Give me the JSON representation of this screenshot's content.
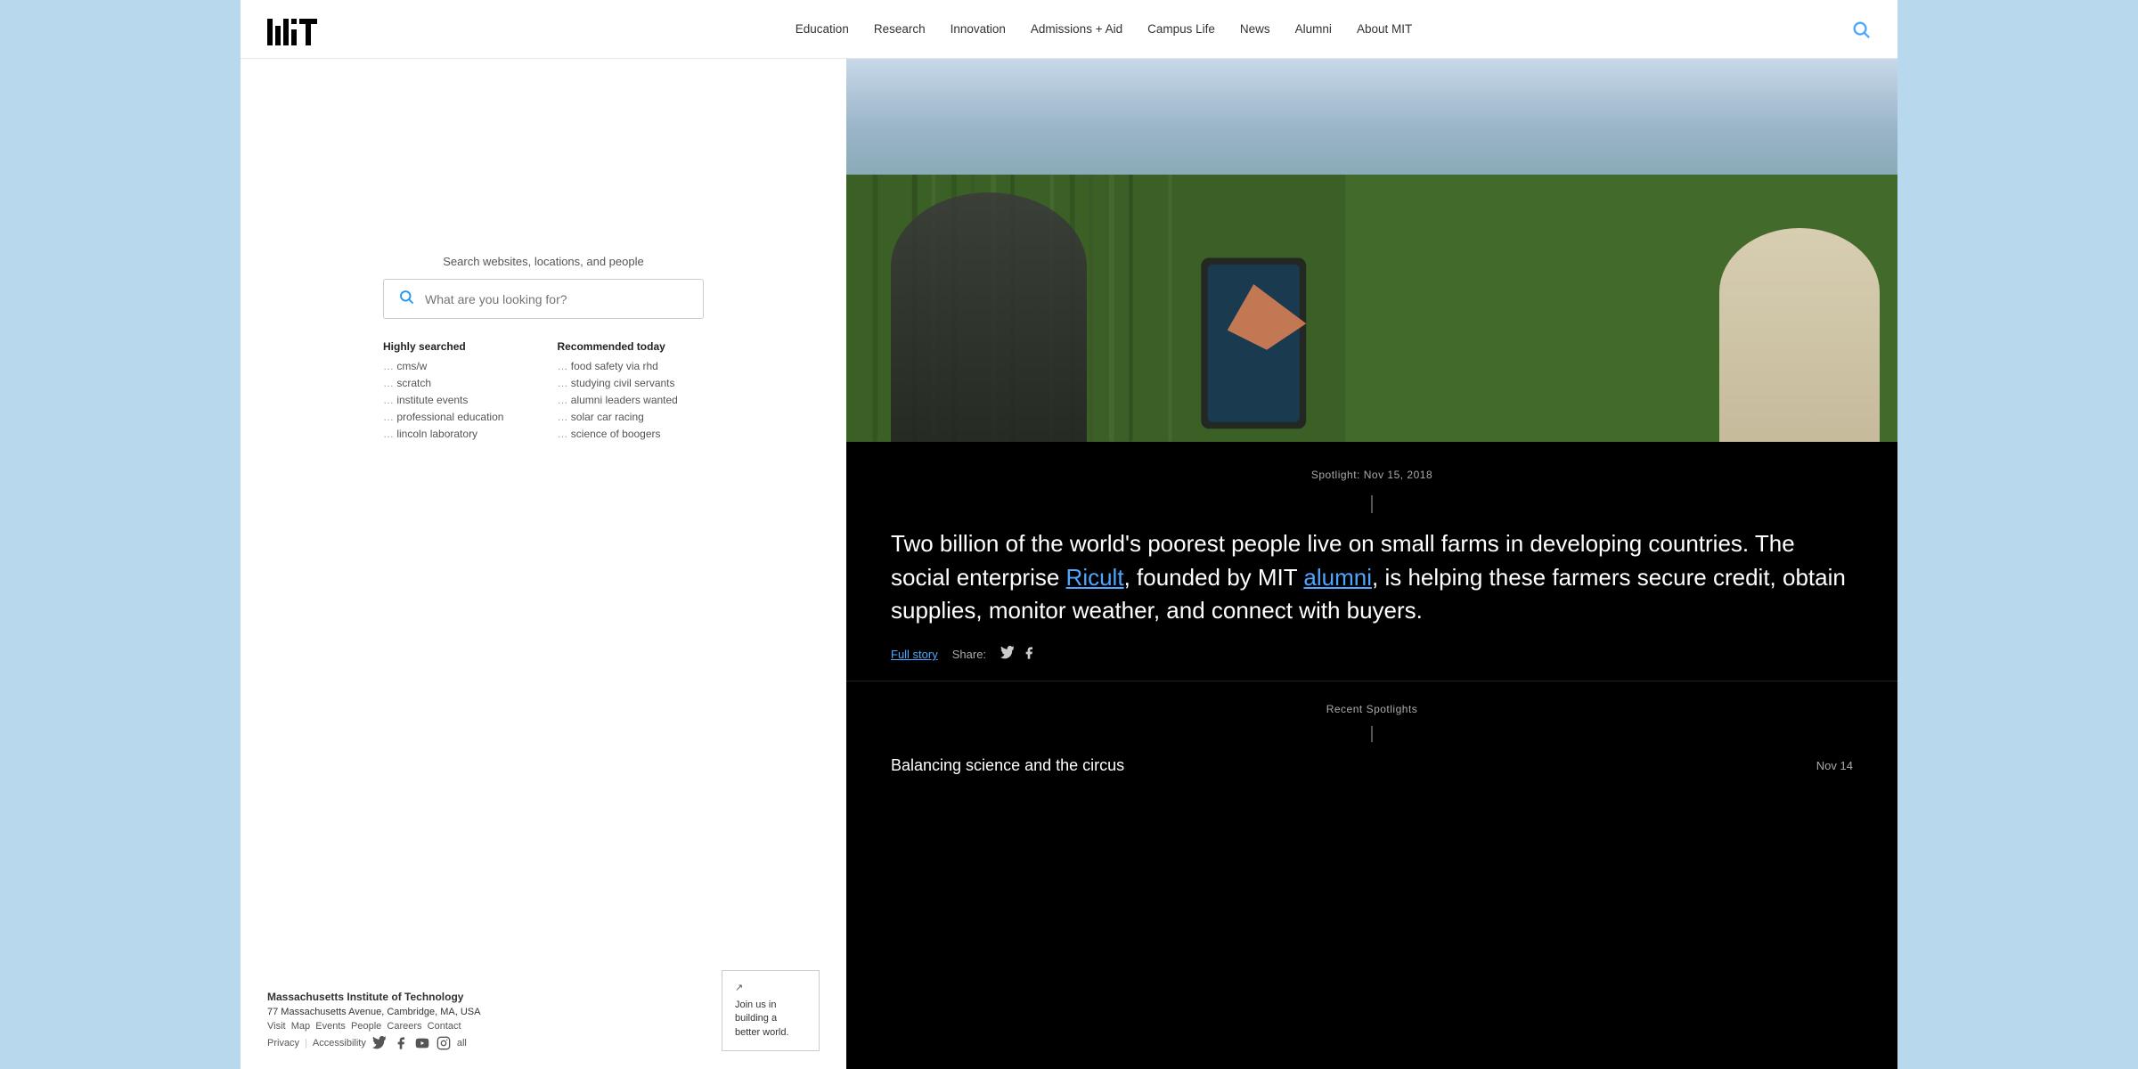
{
  "header": {
    "logo_alt": "MIT",
    "nav_items": [
      "Education",
      "Research",
      "Innovation",
      "Admissions + Aid",
      "Campus Life",
      "News",
      "Alumni",
      "About MIT"
    ]
  },
  "search": {
    "label": "Search websites, locations, and people",
    "placeholder": "What are you looking for?",
    "highly_searched_title": "Highly searched",
    "recommended_title": "Recommended today",
    "highly_searched": [
      "cms/w",
      "scratch",
      "institute events",
      "professional education",
      "lincoln laboratory"
    ],
    "recommended": [
      "food safety via rhd",
      "studying civil servants",
      "alumni leaders wanted",
      "solar car racing",
      "science of boogers"
    ]
  },
  "footer": {
    "institution": "Massachusetts Institute of Technology",
    "address": "77 Massachusetts Avenue, Cambridge, MA, USA",
    "links": [
      "Visit",
      "Map",
      "Events",
      "People",
      "Careers",
      "Contact"
    ],
    "legal_links": [
      "Privacy",
      "Accessibility"
    ],
    "social_links": [
      "twitter",
      "facebook",
      "youtube",
      "instagram",
      "all"
    ],
    "join_box": {
      "line1": "Join us in",
      "line2": "building a",
      "line3": "better world."
    }
  },
  "article": {
    "spotlight_label": "Spotlight: Nov 15, 2018",
    "body_text_part1": "Two billion of the world's poorest people live on small farms in developing countries. The social enterprise ",
    "ricult_link": "Ricult",
    "body_text_part2": ", founded by MIT ",
    "alumni_link": "alumni",
    "body_text_part3": ", is helping these farmers secure credit, obtain supplies, monitor weather, and connect with buyers.",
    "full_story_label": "Full story",
    "share_label": "Share:"
  },
  "recent": {
    "label": "Recent Spotlights",
    "items": [
      {
        "text": "Balancing science and the circus",
        "date": "Nov 14"
      }
    ]
  }
}
